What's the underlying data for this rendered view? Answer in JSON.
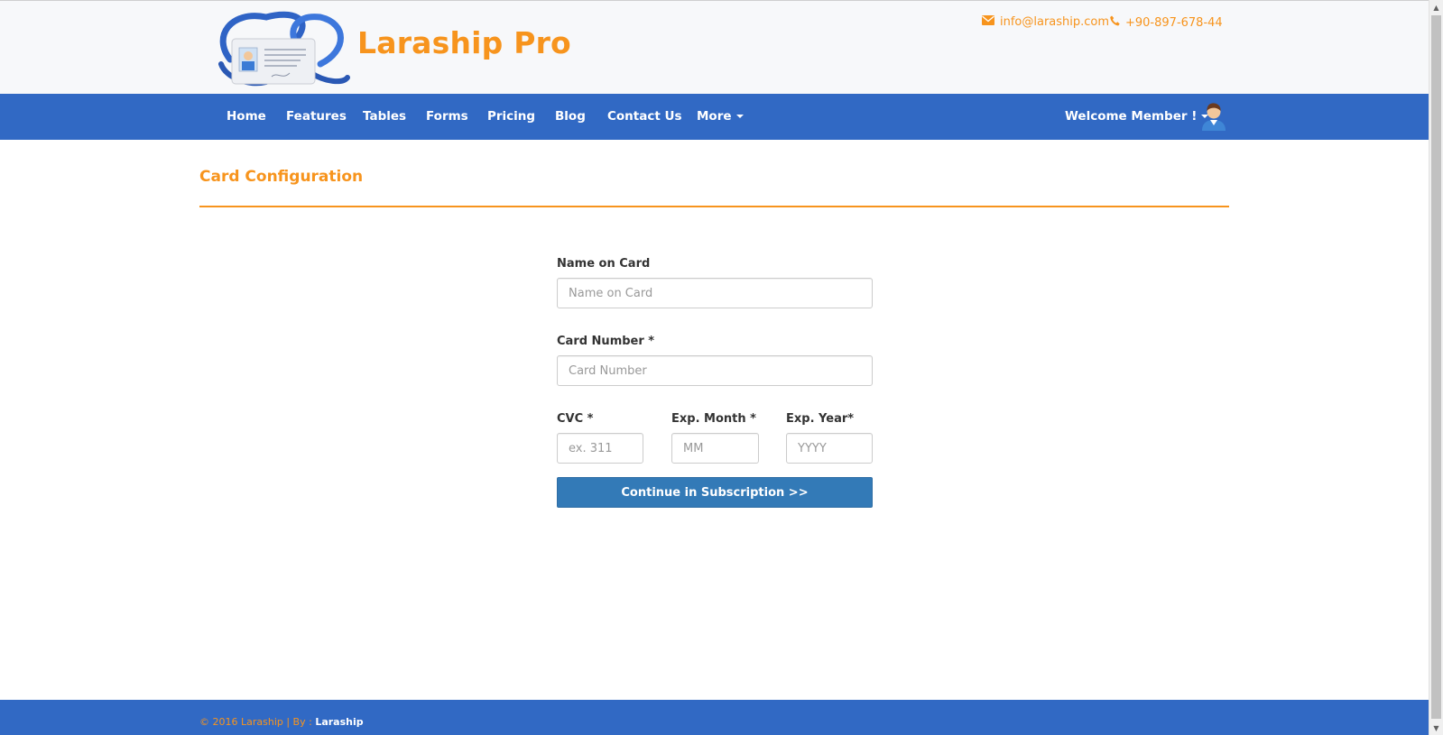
{
  "header": {
    "brand": "Laraship Pro",
    "email": "info@laraship.com",
    "phone": "+90-897-678-44",
    "icons": {
      "email": "envelope-icon",
      "phone": "phone-icon",
      "logo": "id-badge-logo"
    }
  },
  "nav": {
    "items": [
      {
        "label": "Home"
      },
      {
        "label": "Features"
      },
      {
        "label": "Tables"
      },
      {
        "label": "Forms"
      },
      {
        "label": "Pricing"
      },
      {
        "label": "Blog"
      },
      {
        "label": "Contact Us"
      },
      {
        "label": "More"
      }
    ],
    "welcome": "Welcome Member !"
  },
  "page": {
    "title": "Card Configuration"
  },
  "form": {
    "name_label": "Name on Card",
    "name_placeholder": "Name on Card",
    "number_label": "Card Number *",
    "number_placeholder": "Card Number",
    "cvc_label": "CVC *",
    "cvc_placeholder": "ex. 311",
    "month_label": "Exp. Month *",
    "month_placeholder": "MM",
    "year_label": "Exp. Year*",
    "year_placeholder": "YYYY",
    "submit_label": "Continue in Subscription >>"
  },
  "footer": {
    "copyright": "© 2016 Laraship | By : ",
    "author": "Laraship"
  },
  "colors": {
    "accent": "#f7941d",
    "nav_bg": "#3169c4",
    "button_bg": "#337ab7"
  }
}
